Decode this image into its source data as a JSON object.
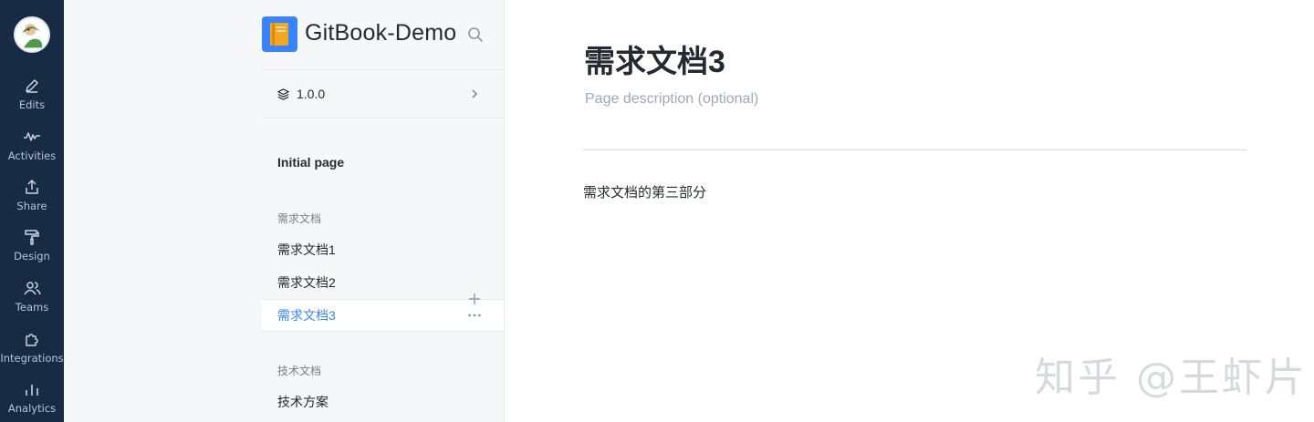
{
  "rail": {
    "items": [
      {
        "label": "Edits",
        "icon": "pencil-icon"
      },
      {
        "label": "Activities",
        "icon": "activity-icon"
      },
      {
        "label": "Share",
        "icon": "share-icon"
      },
      {
        "label": "Design",
        "icon": "paint-roller-icon"
      },
      {
        "label": "Teams",
        "icon": "users-icon"
      },
      {
        "label": "Integrations",
        "icon": "puzzle-icon"
      },
      {
        "label": "Analytics",
        "icon": "bar-chart-icon"
      }
    ]
  },
  "space": {
    "title": "GitBook-Demo"
  },
  "version": {
    "label": "1.0.0"
  },
  "nav": {
    "initial_page": "Initial page",
    "sections": [
      {
        "title": "需求文档",
        "pages": [
          "需求文档1",
          "需求文档2",
          "需求文档3"
        ]
      },
      {
        "title": "技术文档",
        "pages": [
          "技术方案"
        ]
      }
    ]
  },
  "page": {
    "title": "需求文档3",
    "description_placeholder": "Page description (optional)",
    "body": "需求文档的第三部分"
  },
  "watermark": "知乎 @王虾片",
  "colors": {
    "rail": "#182b45",
    "accent": "#3884ff",
    "sidebar": "#f5f7f9"
  }
}
